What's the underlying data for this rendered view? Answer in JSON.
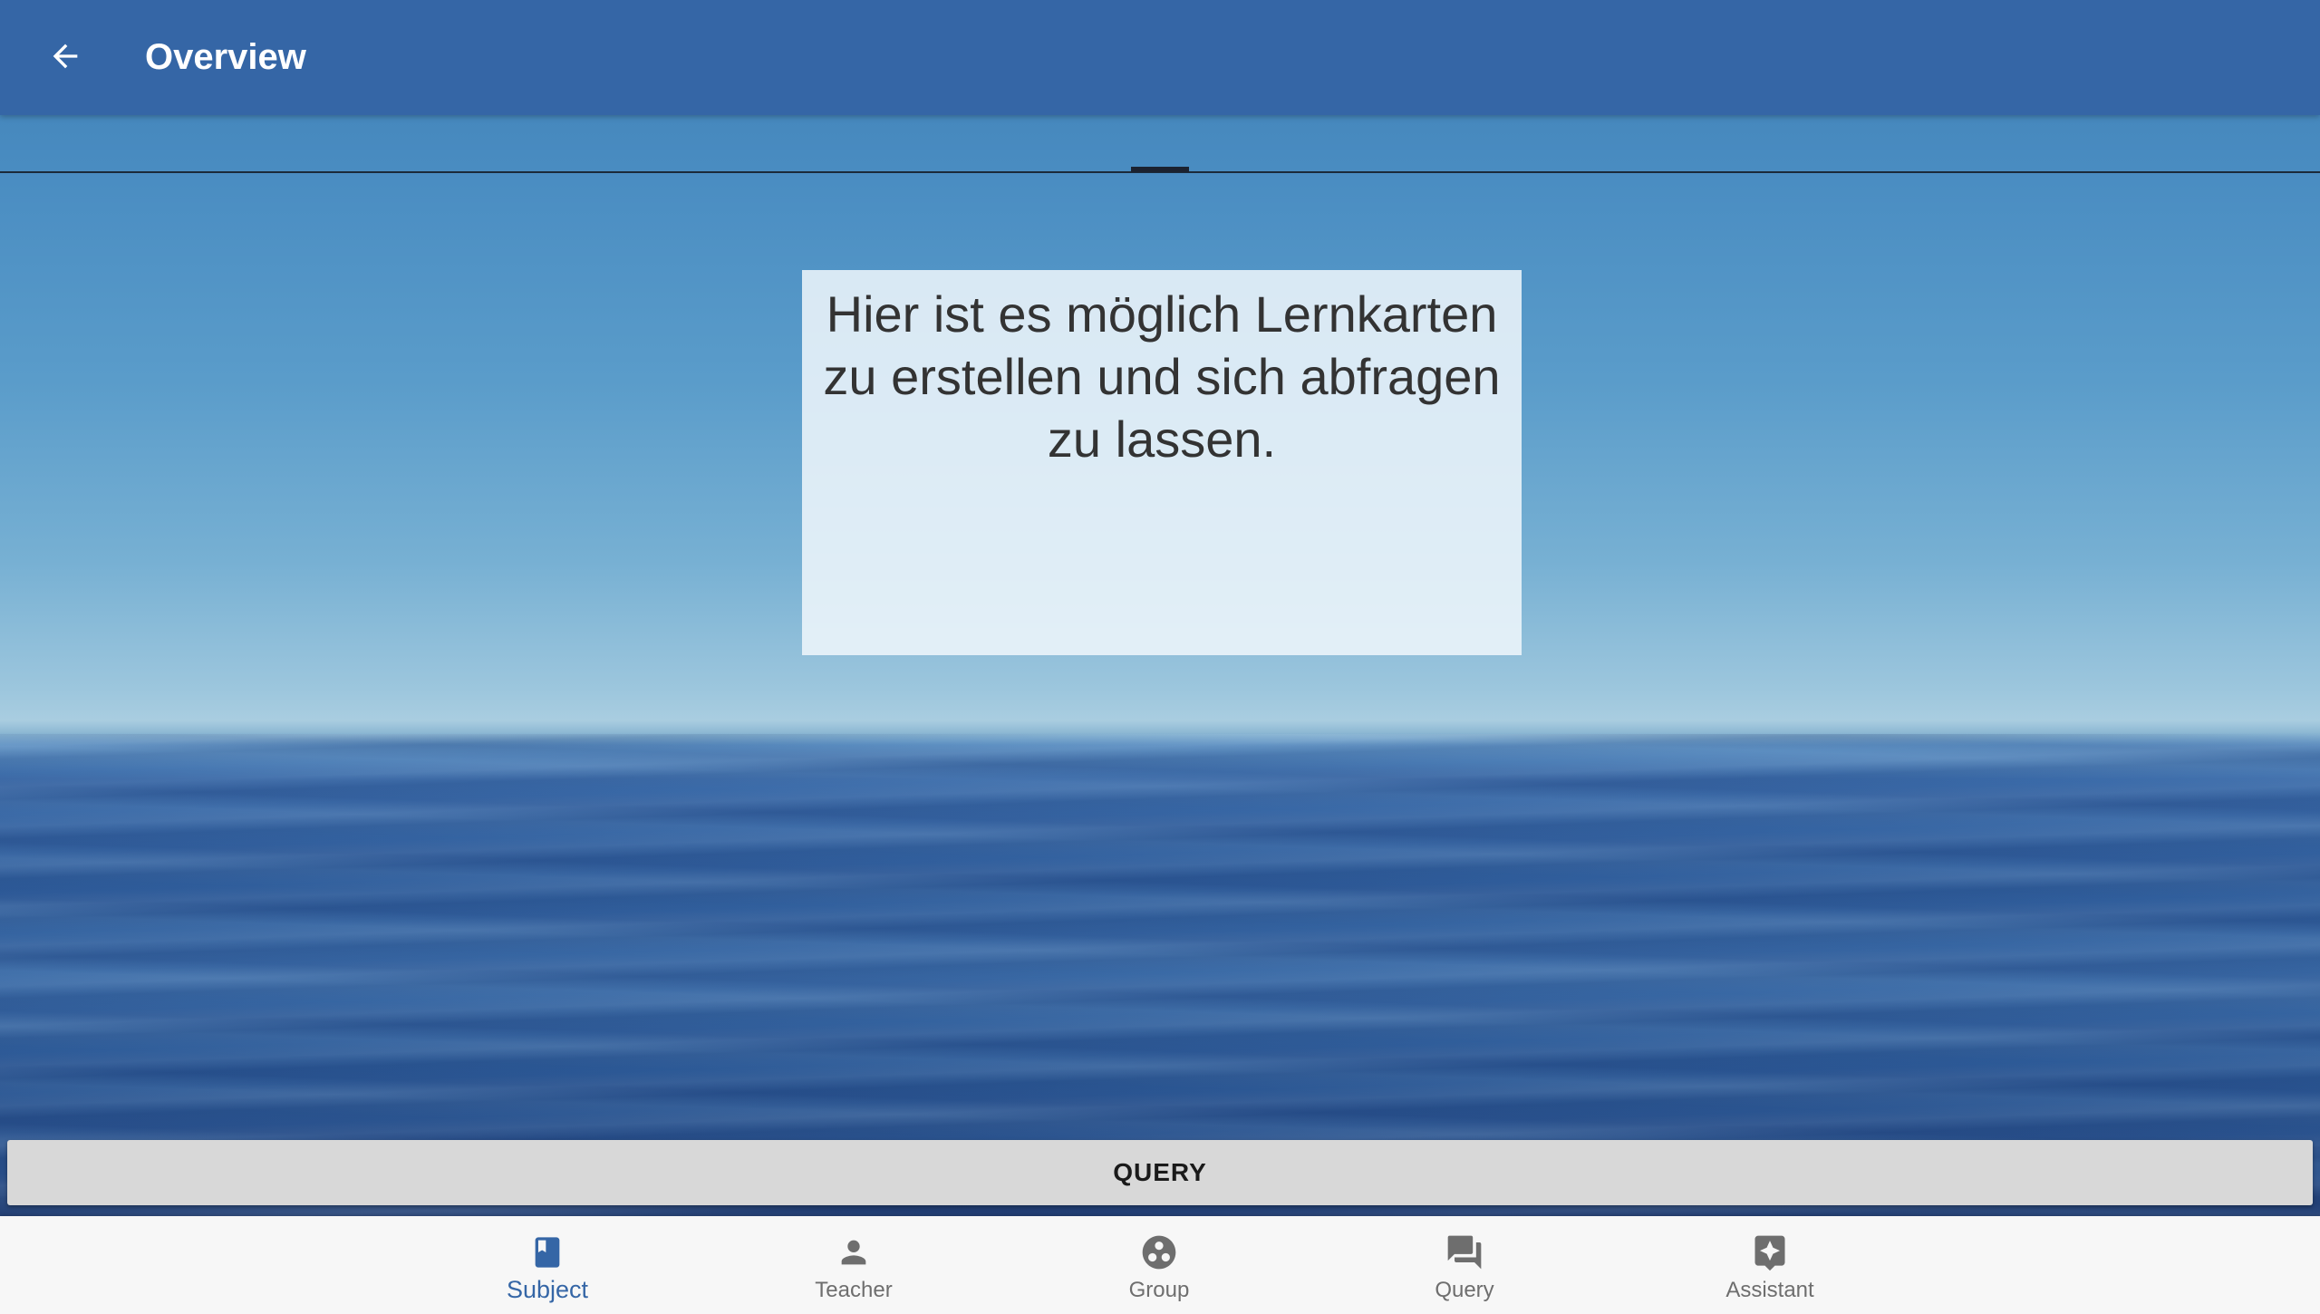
{
  "appbar": {
    "title": "Overview",
    "back_icon": "arrow-left-icon",
    "color": "#3566a6"
  },
  "card": {
    "text": "Hier ist es möglich Lernkarten zu erstellen und sich abfragen zu lassen."
  },
  "query_button": {
    "label": "QUERY"
  },
  "bottom_nav": {
    "active_color": "#3566a6",
    "inactive_color": "#6e6e6e",
    "items": [
      {
        "label": "Subject",
        "icon": "book-icon",
        "active": true
      },
      {
        "label": "Teacher",
        "icon": "person-icon",
        "active": false
      },
      {
        "label": "Group",
        "icon": "group-icon",
        "active": false
      },
      {
        "label": "Query",
        "icon": "chat-icon",
        "active": false
      },
      {
        "label": "Assistant",
        "icon": "assistant-icon",
        "active": false
      }
    ]
  }
}
